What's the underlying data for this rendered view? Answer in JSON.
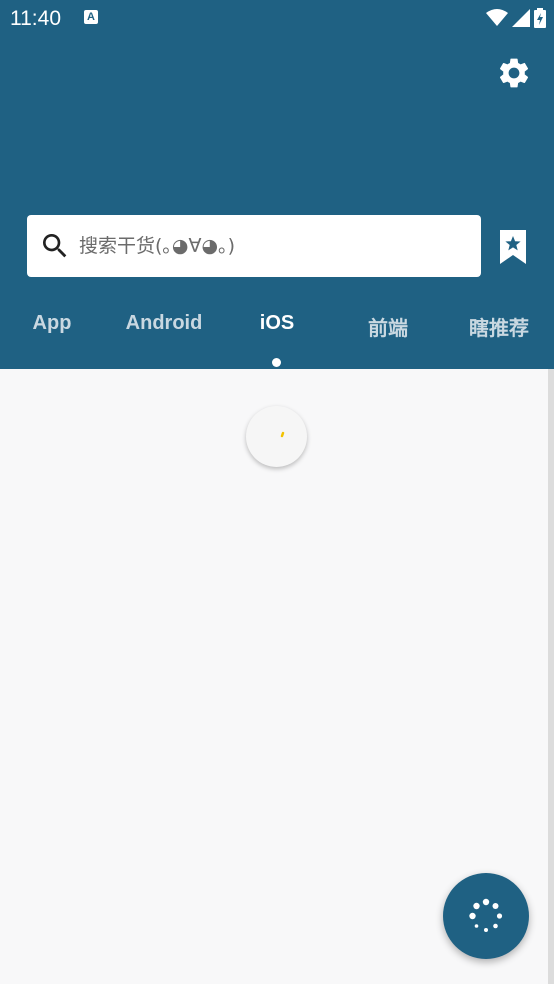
{
  "status_bar": {
    "time": "11:40",
    "notification_letter": "A",
    "icons": [
      "wifi-icon",
      "signal-icon",
      "battery-icon"
    ]
  },
  "header": {
    "settings_icon": "gear-icon",
    "bookmark_icon": "bookmark-star-icon",
    "background_color": "#1f6183"
  },
  "search": {
    "icon": "search-icon",
    "placeholder": "搜索干货(｡◕∀◕｡)",
    "value": ""
  },
  "tabs": [
    {
      "label": "App",
      "active": false
    },
    {
      "label": "Android",
      "active": false
    },
    {
      "label": "iOS",
      "active": true
    },
    {
      "label": "前端",
      "active": false
    },
    {
      "label": "瞎推荐",
      "active": false
    }
  ],
  "loader": {
    "accent_color": "#f2c200"
  },
  "fab": {
    "icon": "loading-dots-icon"
  }
}
